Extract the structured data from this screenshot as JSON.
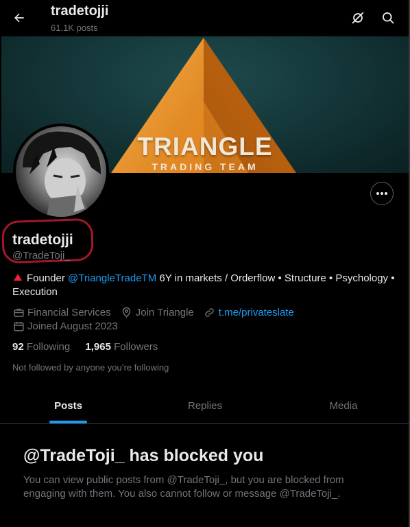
{
  "header": {
    "title": "tradetojji",
    "post_count": "61.1K posts",
    "back_icon": "arrow-left-icon",
    "icons": [
      "grok-icon",
      "search-icon"
    ]
  },
  "banner": {
    "title": "TRIANGLE",
    "subtitle": "TRADING TEAM",
    "colors": {
      "background": "#163a3c",
      "triangle": "#e8952a"
    }
  },
  "profile": {
    "display_name": "tradetojji",
    "handle": "@TradeToji_",
    "bio": {
      "prefix": "Founder ",
      "mention": "@TriangleTradeTM",
      "rest": " 6Y in markets / Orderflow • Structure • Psychology • Execution"
    },
    "category": "Financial Services",
    "location": "Join Triangle",
    "link": "t.me/privateslate",
    "joined": "Joined August 2023",
    "following_count": "92",
    "following_label": "Following",
    "followers_count": "1,965",
    "followers_label": "Followers",
    "not_followed": "Not followed by anyone you’re following"
  },
  "tabs": [
    {
      "label": "Posts",
      "active": true
    },
    {
      "label": "Replies",
      "active": false
    },
    {
      "label": "Media",
      "active": false
    }
  ],
  "blocked": {
    "title": "@TradeToji_ has blocked you",
    "message": "You can view public posts from @TradeToji_, but you are blocked from engaging with them. You also cannot follow or message @TradeToji_."
  },
  "colors": {
    "accent": "#1d9bf0",
    "highlight_circle": "#a2182a",
    "muted_text": "#71767b"
  }
}
